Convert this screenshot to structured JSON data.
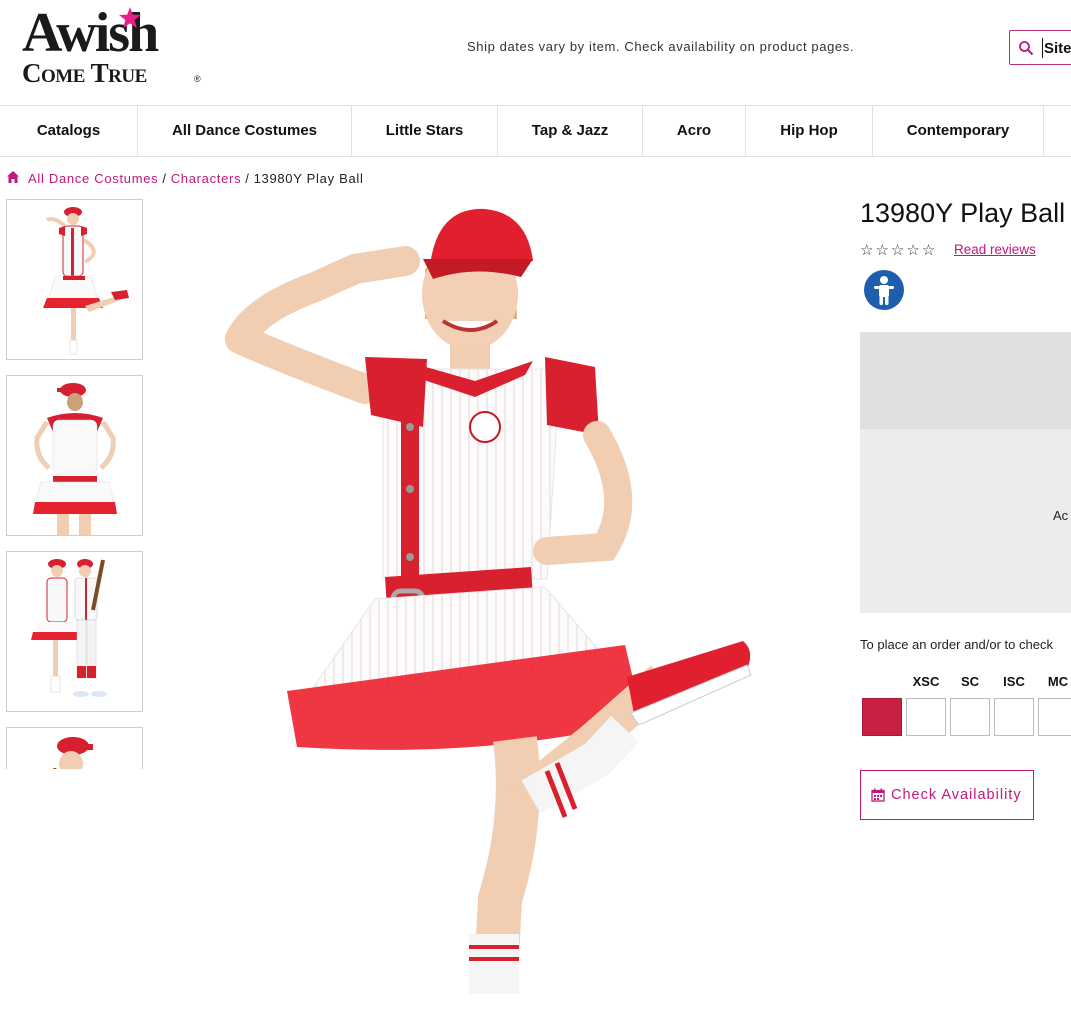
{
  "header": {
    "logo_line1": "Awish",
    "logo_line2": "Come True",
    "logo_registered": "®",
    "ship_notice": "Ship dates vary by item. Check availability on product pages.",
    "search_value": "Site"
  },
  "nav": {
    "items": [
      {
        "label": "Catalogs"
      },
      {
        "label": "All Dance Costumes"
      },
      {
        "label": "Little Stars"
      },
      {
        "label": "Tap & Jazz"
      },
      {
        "label": "Acro"
      },
      {
        "label": "Hip Hop"
      },
      {
        "label": "Contemporary"
      }
    ]
  },
  "breadcrumb": {
    "crumb1": "All Dance Costumes",
    "sep": "/",
    "crumb2": "Characters",
    "current": "13980Y Play Ball"
  },
  "product": {
    "title": "13980Y Play Ball",
    "stars": "☆☆☆☆☆",
    "rating_value": 0,
    "rating_max": 5,
    "read_reviews": "Read reviews",
    "info_box_text": "Ac",
    "order_note": "To place an order and/or to check",
    "sizes": [
      "XSC",
      "SC",
      "ISC",
      "MC"
    ],
    "selected_color": "#c81f45",
    "check_availability": "Check Availability"
  },
  "colors": {
    "accent": "#c2177b",
    "costume_red": "#d7202f",
    "age_badge_blue": "#1d5fae"
  },
  "icons": {
    "home": "home-icon",
    "search": "search-icon",
    "calendar": "calendar-icon",
    "child": "child-age-icon",
    "star": "star-icon"
  }
}
